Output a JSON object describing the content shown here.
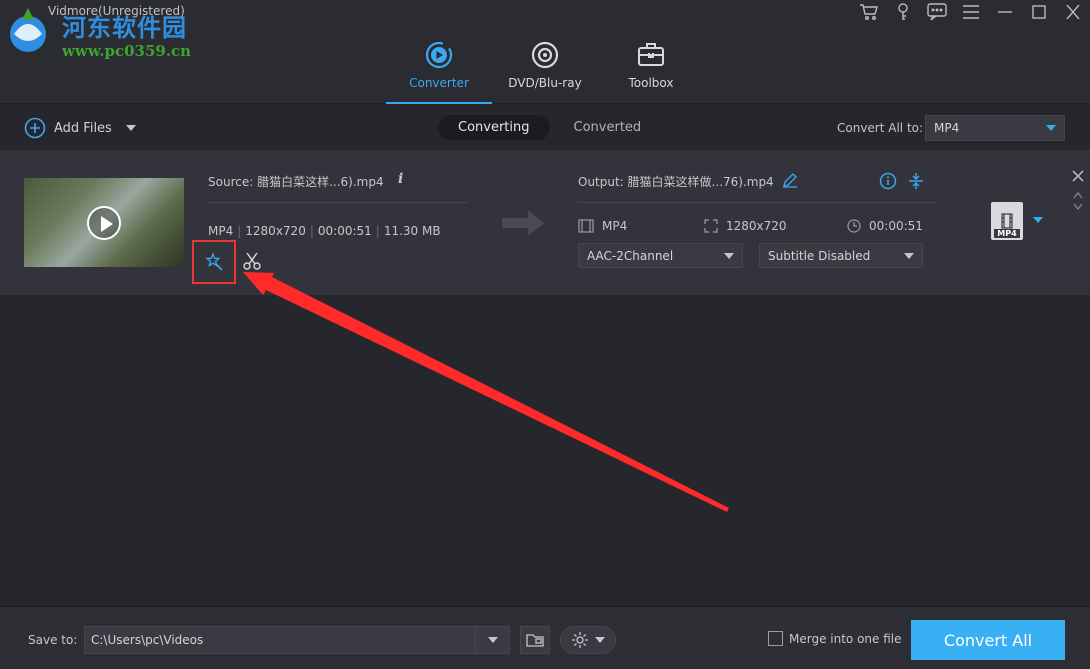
{
  "app": {
    "title": "Vidmore(Unregistered)",
    "watermark_text": "河东软件园",
    "watermark_url": "www.pc0359.cn"
  },
  "window_icons": [
    "cart-icon",
    "key-icon",
    "feedback-icon",
    "menu-icon",
    "minimize-icon",
    "maximize-icon",
    "close-icon"
  ],
  "main_tabs": [
    {
      "label": "Converter",
      "icon": "converter-icon",
      "active": true
    },
    {
      "label": "DVD/Blu-ray",
      "icon": "disc-icon",
      "active": false
    },
    {
      "label": "Toolbox",
      "icon": "toolbox-icon",
      "active": false
    }
  ],
  "toolbar": {
    "add_files_label": "Add Files",
    "sub_tabs": [
      {
        "label": "Converting",
        "active": true
      },
      {
        "label": "Converted",
        "active": false
      }
    ],
    "convert_all_to_label": "Convert All to:",
    "convert_all_to_value": "MP4"
  },
  "file": {
    "source_label": "Source: 腊猫白菜这样...6).mp4",
    "source_format": "MP4",
    "source_resolution": "1280x720",
    "source_duration": "00:00:51",
    "source_size": "11.30 MB",
    "output_label": "Output: 腊猫白菜这样做...76).mp4",
    "output_format": "MP4",
    "output_resolution": "1280x720",
    "output_duration": "00:00:51",
    "audio_track": "AAC-2Channel",
    "subtitle": "Subtitle Disabled",
    "format_badge": "MP4"
  },
  "bottom": {
    "save_to_label": "Save to:",
    "save_path": "C:\\Users\\pc\\Videos",
    "merge_label": "Merge into one file",
    "merge_checked": false,
    "convert_all_label": "Convert All"
  },
  "colors": {
    "accent": "#3aa8f2",
    "background": "#26272d",
    "highlight_box": "#e53935",
    "annotation_arrow": "#ff2a2a"
  }
}
